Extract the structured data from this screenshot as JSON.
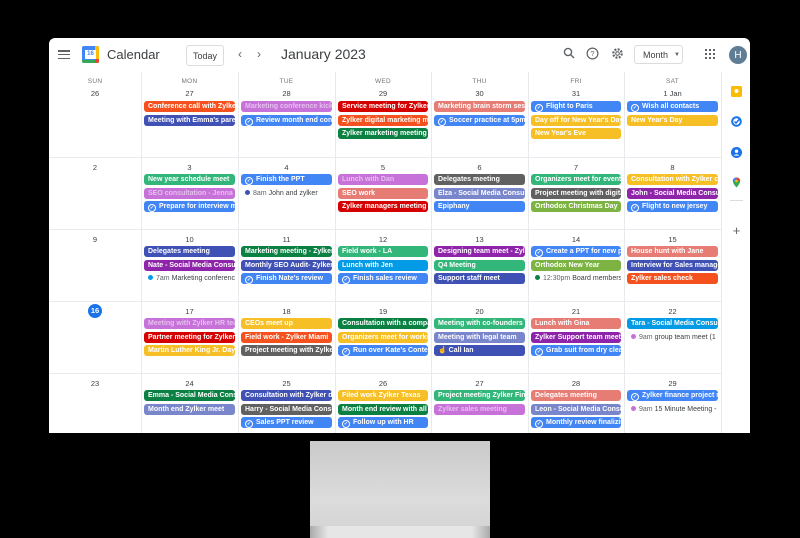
{
  "app": {
    "title": "Calendar",
    "logo_day": "16",
    "today_label": "Today",
    "prev_label": "‹",
    "next_label": "›",
    "month_title": "January 2023",
    "view_label": "Month",
    "avatar_initial": "H",
    "icons": [
      "menu-icon",
      "search-icon",
      "help-icon",
      "settings-icon",
      "apps-icon"
    ]
  },
  "weekdays": [
    "SUN",
    "MON",
    "TUE",
    "WED",
    "THU",
    "FRI",
    "SAT"
  ],
  "side_panel": {
    "icons": [
      "keep-icon",
      "tasks-icon",
      "contacts-icon",
      "maps-icon",
      "add-icon"
    ]
  },
  "colors": {
    "tomato": "#d50000",
    "tangerine": "#f4511e",
    "lavender": "#7986cb",
    "grape": "#8e24aa",
    "flamingo": "#e67c73",
    "banana": "#f6bf26",
    "sage": "#33b679",
    "basil": "#0b8043",
    "peacock": "#039be5",
    "blueberry": "#3f51b5",
    "graphite": "#616161",
    "blue": "#4285f4",
    "pistachio": "#7cb342",
    "orchid": "#c772d9",
    "today": "#1a73e8"
  },
  "weeks": [
    {
      "days": [
        {
          "label": "26",
          "events": []
        },
        {
          "label": "27",
          "events": [
            {
              "title": "Conference call with Zylker",
              "color": "tangerine"
            },
            {
              "title": "Meeting with Emma's parents",
              "color": "blueberry"
            }
          ]
        },
        {
          "label": "28",
          "events": [
            {
              "title": "Marketing conference kickoff",
              "color": "orchid",
              "dim": true
            },
            {
              "title": "Review month end contracts",
              "color": "blue",
              "task": true
            }
          ]
        },
        {
          "label": "29",
          "events": [
            {
              "title": "Service meeting for Zylker f",
              "color": "tomato"
            },
            {
              "title": "Zylker digital marketing meet",
              "color": "tangerine"
            },
            {
              "title": "Zylker marketing meeting",
              "color": "basil"
            }
          ]
        },
        {
          "label": "30",
          "events": [
            {
              "title": "Marketing brain storm session",
              "color": "flamingo"
            },
            {
              "title": "Soccer practice at 5pm",
              "color": "blue",
              "task": true
            }
          ]
        },
        {
          "label": "31",
          "events": [
            {
              "title": "Flight to Paris",
              "color": "blue",
              "task": true
            },
            {
              "title": "Day off for New Year's Day",
              "color": "banana"
            },
            {
              "title": "New Year's Eve",
              "color": "banana"
            }
          ]
        },
        {
          "label": "1 Jan",
          "events": [
            {
              "title": "Wish all contacts",
              "color": "blue",
              "task": true
            },
            {
              "title": "New Year's Day",
              "color": "banana"
            }
          ]
        }
      ]
    },
    {
      "days": [
        {
          "label": "2",
          "events": []
        },
        {
          "label": "3",
          "events": [
            {
              "title": "New year schedule meet",
              "color": "sage"
            },
            {
              "title": "SEO consultation - Jenna",
              "color": "orchid",
              "dim": true
            },
            {
              "title": "Prepare for interview meet",
              "color": "blue",
              "task": true
            }
          ]
        },
        {
          "label": "4",
          "events": [
            {
              "title": "Finish the PPT",
              "color": "blue",
              "task": true
            },
            {
              "title": "John and zylker",
              "time": "8am",
              "color": "blueberry",
              "dot": true
            }
          ]
        },
        {
          "label": "5",
          "events": [
            {
              "title": "Lunch with Dan",
              "color": "orchid",
              "dim": true
            },
            {
              "title": "SEO work",
              "color": "flamingo"
            },
            {
              "title": "Zylker managers meeting",
              "color": "tomato"
            }
          ]
        },
        {
          "label": "6",
          "events": [
            {
              "title": "Delegates meeting",
              "color": "graphite"
            },
            {
              "title": "Elza - Social Media Consultation",
              "color": "lavender"
            },
            {
              "title": "Epiphany",
              "color": "blue"
            }
          ]
        },
        {
          "label": "7",
          "events": [
            {
              "title": "Organizers meet for event",
              "color": "sage"
            },
            {
              "title": "Project meeting with digital",
              "color": "graphite"
            },
            {
              "title": "Orthodox Christmas Day",
              "color": "pistachio"
            }
          ]
        },
        {
          "label": "8",
          "events": [
            {
              "title": "Consultation with Zylker co",
              "color": "banana"
            },
            {
              "title": "John - Social Media Consult",
              "color": "grape"
            },
            {
              "title": "Flight to new jersey",
              "color": "blue",
              "task": true
            }
          ]
        }
      ]
    },
    {
      "days": [
        {
          "label": "9",
          "events": []
        },
        {
          "label": "10",
          "events": [
            {
              "title": "Delegates meeting",
              "color": "blueberry"
            },
            {
              "title": "Nate - Social Media Consult",
              "color": "grape"
            },
            {
              "title": "Marketing conference",
              "time": "7am",
              "color": "peacock",
              "dot": true
            }
          ]
        },
        {
          "label": "11",
          "events": [
            {
              "title": "Marketing meeting - Zylker",
              "color": "basil"
            },
            {
              "title": "Monthly SEO Audit- Zylker",
              "color": "blueberry"
            },
            {
              "title": "Finish Nate's review",
              "color": "blue",
              "task": true
            }
          ]
        },
        {
          "label": "12",
          "events": [
            {
              "title": "Field work - LA",
              "color": "sage"
            },
            {
              "title": "Lunch with Jen",
              "color": "peacock"
            },
            {
              "title": "Finish sales review",
              "color": "blue",
              "task": true
            }
          ]
        },
        {
          "label": "13",
          "events": [
            {
              "title": "Designing team meet - Zylker",
              "color": "grape"
            },
            {
              "title": "Q4 Meeting",
              "color": "sage"
            },
            {
              "title": "Support staff meet",
              "color": "blueberry"
            }
          ]
        },
        {
          "label": "14",
          "events": [
            {
              "title": "Create a PPT for new product",
              "color": "blue",
              "task": true
            },
            {
              "title": "Orthodox New Year",
              "color": "pistachio"
            },
            {
              "title": "Board members meet",
              "time": "12:30pm",
              "color": "basil",
              "dot": true
            }
          ]
        },
        {
          "label": "15",
          "events": [
            {
              "title": "House hunt with Jane",
              "color": "flamingo"
            },
            {
              "title": "Interview for Sales manager",
              "color": "blueberry"
            },
            {
              "title": "Zylker sales check",
              "color": "tangerine"
            }
          ]
        }
      ]
    },
    {
      "days": [
        {
          "label": "16",
          "today": true,
          "events": []
        },
        {
          "label": "17",
          "events": [
            {
              "title": "Meeting with Zylker HR team",
              "color": "orchid",
              "dim": true
            },
            {
              "title": "Partner meeting for Zylker I",
              "color": "tomato"
            },
            {
              "title": "Martin Luther King Jr. Day",
              "color": "banana"
            }
          ]
        },
        {
          "label": "18",
          "events": [
            {
              "title": "CEOs meet up",
              "color": "banana"
            },
            {
              "title": "Field work - Zylker Miami",
              "color": "tangerine"
            },
            {
              "title": "Project meeting with Zylker",
              "color": "graphite"
            }
          ]
        },
        {
          "label": "19",
          "events": [
            {
              "title": "Consultation with a company",
              "color": "basil"
            },
            {
              "title": "Organizers meet for workshop",
              "color": "banana"
            },
            {
              "title": "Run over Kate's Content",
              "color": "blue",
              "task": true
            }
          ]
        },
        {
          "label": "20",
          "events": [
            {
              "title": "Meeting with co-founders",
              "color": "sage"
            },
            {
              "title": "Meeting with legal team",
              "color": "lavender"
            },
            {
              "title": "Call Ian",
              "color": "blueberry",
              "icon": true
            }
          ]
        },
        {
          "label": "21",
          "events": [
            {
              "title": "Lunch with Gina",
              "color": "flamingo"
            },
            {
              "title": "Zylker Support team meeting",
              "color": "grape"
            },
            {
              "title": "Grab suit from dry cleaners",
              "color": "blue",
              "task": true
            }
          ]
        },
        {
          "label": "22",
          "events": [
            {
              "title": "Tara - Social Media Consult",
              "color": "peacock"
            },
            {
              "title": "group team meet (1 c",
              "time": "9am",
              "color": "orchid",
              "dot": true
            }
          ]
        }
      ]
    },
    {
      "days": [
        {
          "label": "23",
          "events": []
        },
        {
          "label": "24",
          "events": [
            {
              "title": "Emma - Social Media Consult",
              "color": "basil"
            },
            {
              "title": "Month end Zylker meet",
              "color": "lavender"
            }
          ]
        },
        {
          "label": "25",
          "events": [
            {
              "title": "Consultation with Zylker dev",
              "color": "blueberry"
            },
            {
              "title": "Harry - Social Media Consult",
              "color": "graphite"
            },
            {
              "title": "Sales PPT review",
              "color": "blue",
              "task": true
            }
          ]
        },
        {
          "label": "26",
          "events": [
            {
              "title": "Filed work Zylker Texas",
              "color": "banana"
            },
            {
              "title": "Month end review with all team",
              "color": "basil"
            },
            {
              "title": "Follow up with HR",
              "color": "blue",
              "task": true
            }
          ]
        },
        {
          "label": "27",
          "events": [
            {
              "title": "Project meeting Zylker Finance",
              "color": "sage"
            },
            {
              "title": "Zylker sales meeting",
              "color": "orchid",
              "dim": true
            }
          ]
        },
        {
          "label": "28",
          "events": [
            {
              "title": "Delegates meeting",
              "color": "flamingo"
            },
            {
              "title": "Leon - Social Media Consult",
              "color": "lavender"
            },
            {
              "title": "Monthly review finalizing",
              "color": "blue",
              "task": true
            }
          ]
        },
        {
          "label": "29",
          "events": [
            {
              "title": "Zylker finance project review",
              "color": "blue",
              "task": true
            },
            {
              "title": "15 Minute Meeting -",
              "time": "9am",
              "color": "orchid",
              "dot": true
            }
          ]
        }
      ]
    }
  ]
}
